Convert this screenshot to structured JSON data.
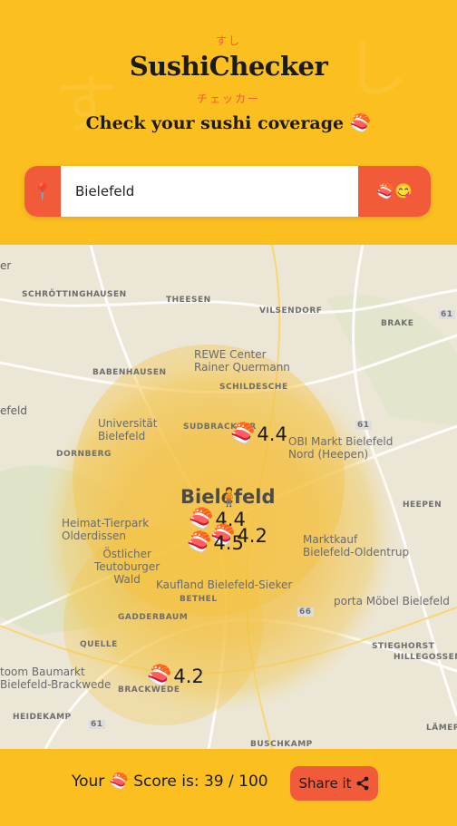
{
  "header": {
    "kana_top": "すし",
    "logo": "SushiChecker",
    "kana_bottom": "チェッカー",
    "tagline": "Check your sushi coverage 🍣"
  },
  "search": {
    "value": "Bielefeld",
    "button_label": "🍣😋",
    "pin_icon": "📍"
  },
  "map": {
    "labels": {
      "schroettinghausen": "SCHRÖTTINGHAUSEN",
      "theesen": "THEESEN",
      "vilsendorf": "VILSENDORF",
      "brake": "BRAKE",
      "babenhausen": "BABENHAUSEN",
      "rewe": "REWE Center\nRainer Quermann",
      "schildesche": "SCHILDESCHE",
      "universitaet": "Universität\nBielefeld",
      "dornberg": "DORNBERG",
      "sudbrackstr": "SUDBRACKSTR",
      "obi": "OBI Markt Bielefeld\nNord (Heepen)",
      "heepen": "HEEPEN",
      "bielefeld_left": "efeld",
      "city": "Bielefeld",
      "heimat": "Heimat-Tierpark\nOlderdissen",
      "marktkauf": "Marktkauf\nBielefeld-Oldentrup",
      "oestlicher": "Östlicher\nTeutoburger\nWald",
      "kaufland": "Kaufland Bielefeld-Sieker",
      "bethel": "BETHEL",
      "gadderbaum": "GADDERBAUM",
      "porta": "porta Möbel Bielefeld",
      "quelle": "QUELLE",
      "stieghorst": "STIEGHORST",
      "hillegossen": "HILLEGOSSEN",
      "toom": "toom Baumarkt\nBielefeld-Brackwede",
      "brackwede": "BRACKWEDE",
      "heidekamp": "HEIDEKAMP",
      "buschkamp": "BUSCHKAMP",
      "lammers": "LÄMERS",
      "er": "er",
      "road61a": "61",
      "road61b": "61",
      "road66": "66",
      "road61c": "61"
    },
    "markers": [
      {
        "rating": "4.4",
        "icon": "🍣"
      },
      {
        "rating": "4.4",
        "icon": "🍣"
      },
      {
        "rating": "4.2",
        "icon": "🍣"
      },
      {
        "rating": "4.5",
        "icon": "🍣"
      },
      {
        "rating": "4.2",
        "icon": "🍣"
      }
    ],
    "user_icon": "🧍"
  },
  "footer": {
    "score_text": "Your 🍣 Score is: 39 / 100",
    "score_value": 39,
    "score_max": 100,
    "share_label": "Share it",
    "share_icon": "share-icon"
  },
  "colors": {
    "background": "#fbbf1f",
    "accent": "#f15b3a"
  }
}
